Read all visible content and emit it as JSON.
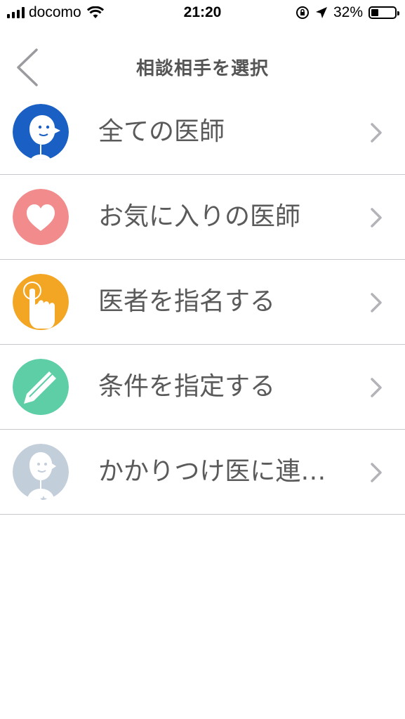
{
  "status_bar": {
    "carrier": "docomo",
    "time": "21:20",
    "battery_percent": "32%",
    "battery_level": 0.32,
    "icons": [
      "signal-icon",
      "wifi-icon",
      "orientation-lock-icon",
      "location-icon",
      "battery-icon"
    ]
  },
  "nav": {
    "title": "相談相手を選択",
    "back_icon": "back-chevron-icon"
  },
  "list": {
    "items": [
      {
        "label": "全ての医師",
        "icon": "doctor-avatar-icon",
        "icon_color": "#1a5fc4"
      },
      {
        "label": "お気に入りの医師",
        "icon": "heart-icon",
        "icon_color": "#f28b8b"
      },
      {
        "label": "医者を指名する",
        "icon": "pointing-hand-icon",
        "icon_color": "#f3a623"
      },
      {
        "label": "条件を指定する",
        "icon": "pencil-icon",
        "icon_color": "#5dcea6"
      },
      {
        "label": "かかりつけ医に連…",
        "icon": "family-doctor-icon",
        "icon_color": "#c3cedb"
      }
    ],
    "chevron_icon": "chevron-right-icon"
  },
  "colors": {
    "separator": "#c8c8cc",
    "label_text": "#5a5a5a",
    "chevron": "#b3b3b8"
  }
}
